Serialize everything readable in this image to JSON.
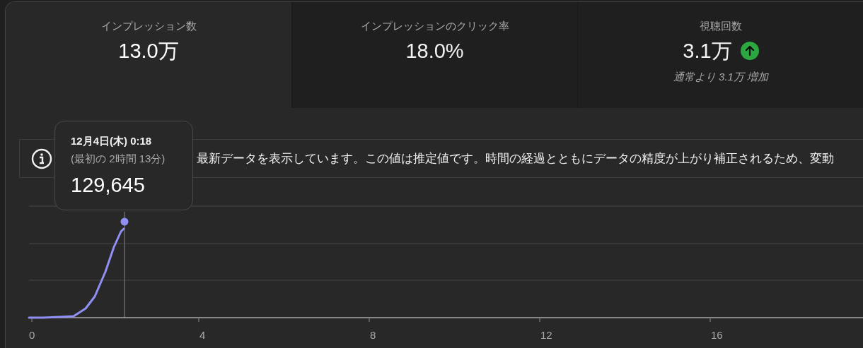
{
  "metrics": [
    {
      "label": "インプレッション数",
      "value": "13.0万",
      "selected": true
    },
    {
      "label": "インプレッションのクリック率",
      "value": "18.0%",
      "selected": false
    },
    {
      "label": "視聴回数",
      "value": "3.1万",
      "selected": false,
      "trend_up": true,
      "note": "通常より 3.1万 増加"
    }
  ],
  "info_banner": {
    "text": "最新データを表示しています。この値は推定値です。時間の経過とともにデータの精度が上がり補正されるため、変動"
  },
  "chart": {
    "tooltip": {
      "date": "12月4日(木) 0:18",
      "elapsed": "(最初の 2時間 13分)",
      "value": "129,645"
    },
    "x_labels": [
      "0",
      "4",
      "8",
      "12",
      "16"
    ]
  }
}
